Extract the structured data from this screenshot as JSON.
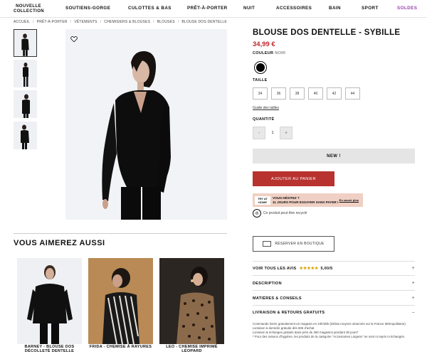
{
  "header": {
    "logo_line1": "NOUVELLE",
    "logo_line2": "COLLECTION",
    "nav": [
      "SOUTIENS-GORGE",
      "CULOTTES & BAS",
      "PRÊT-À-PORTER",
      "NUIT",
      "ACCESSOIRES",
      "BAIN",
      "SPORT",
      "SOLDES"
    ],
    "soldes_color": "#9b3fb0"
  },
  "breadcrumb": [
    "ACCUEIL",
    "PRÊT-À-PORTER",
    "VÊTEMENTS",
    "CHEMISIERS & BLOUSES",
    "BLOUSES",
    "BLOUSE DOS DENTELLE"
  ],
  "product": {
    "title": "BLOUSE DOS DENTELLE - SYBILLE",
    "price": "34,99 €",
    "price_color": "#c0262d",
    "color_label": "COULEUR",
    "color_value": "NOIR",
    "size_label": "TAILLE",
    "sizes": [
      "34",
      "36",
      "38",
      "40",
      "42",
      "44"
    ],
    "size_guide": "Guide des tailles",
    "quantity_label": "QUANTITÉ",
    "quantity": "1",
    "minus": "-",
    "plus": "+",
    "badge_new": "NEW !",
    "add_to_cart": "AJOUTER AU PANIER",
    "promo_badge": "TRY AT HOME",
    "promo_line1": "VOUS HÉSITEZ ?",
    "promo_line2": "11 JOURS POUR ESSAYER SANS PAYER !",
    "promo_link": "En savoir plus",
    "eco_text": "Ce produit peut être recyclé",
    "reserve": "RÉSERVER EN BOUTIQUE"
  },
  "accordion": {
    "reviews_label": "VOIR TOUS LES AVIS",
    "stars": "★★★★★",
    "rating": "5,00/5",
    "description": "DESCRIPTION",
    "materials": "MATIÈRES & CONSEILS",
    "delivery": "LIVRAISON & RETOURS GRATUITS",
    "expand_icon": "+",
    "collapse_icon": "−",
    "delivery_text_1": "Commande livrée gratuitement en magasin en 24h/48h (Délais moyens observés sur la France Métropolitaine).",
    "delivery_text_2": "Livraison à domicile gratuite dès 60€ d'achat",
    "delivery_text_3": "Livraison & échanges gratuits dans près de 450 magasins pendant 30 jours*",
    "delivery_text_4": "* Pour des raisons d'hygiène, les produits de la catégorie \"Accessoires Lingerie\" ne sont ni repris ni échangés."
  },
  "recommendations": {
    "title": "VOUS AIMEREZ AUSSI",
    "items": [
      {
        "label": "BARNEY - BLOUSE DOS DÉCOLLETÉ DENTELLE"
      },
      {
        "label": "FRIDA - CHEMISE À RAYURES"
      },
      {
        "label": "LEO - CHEMISE IMPRIMÉ LÉOPARD"
      }
    ]
  }
}
